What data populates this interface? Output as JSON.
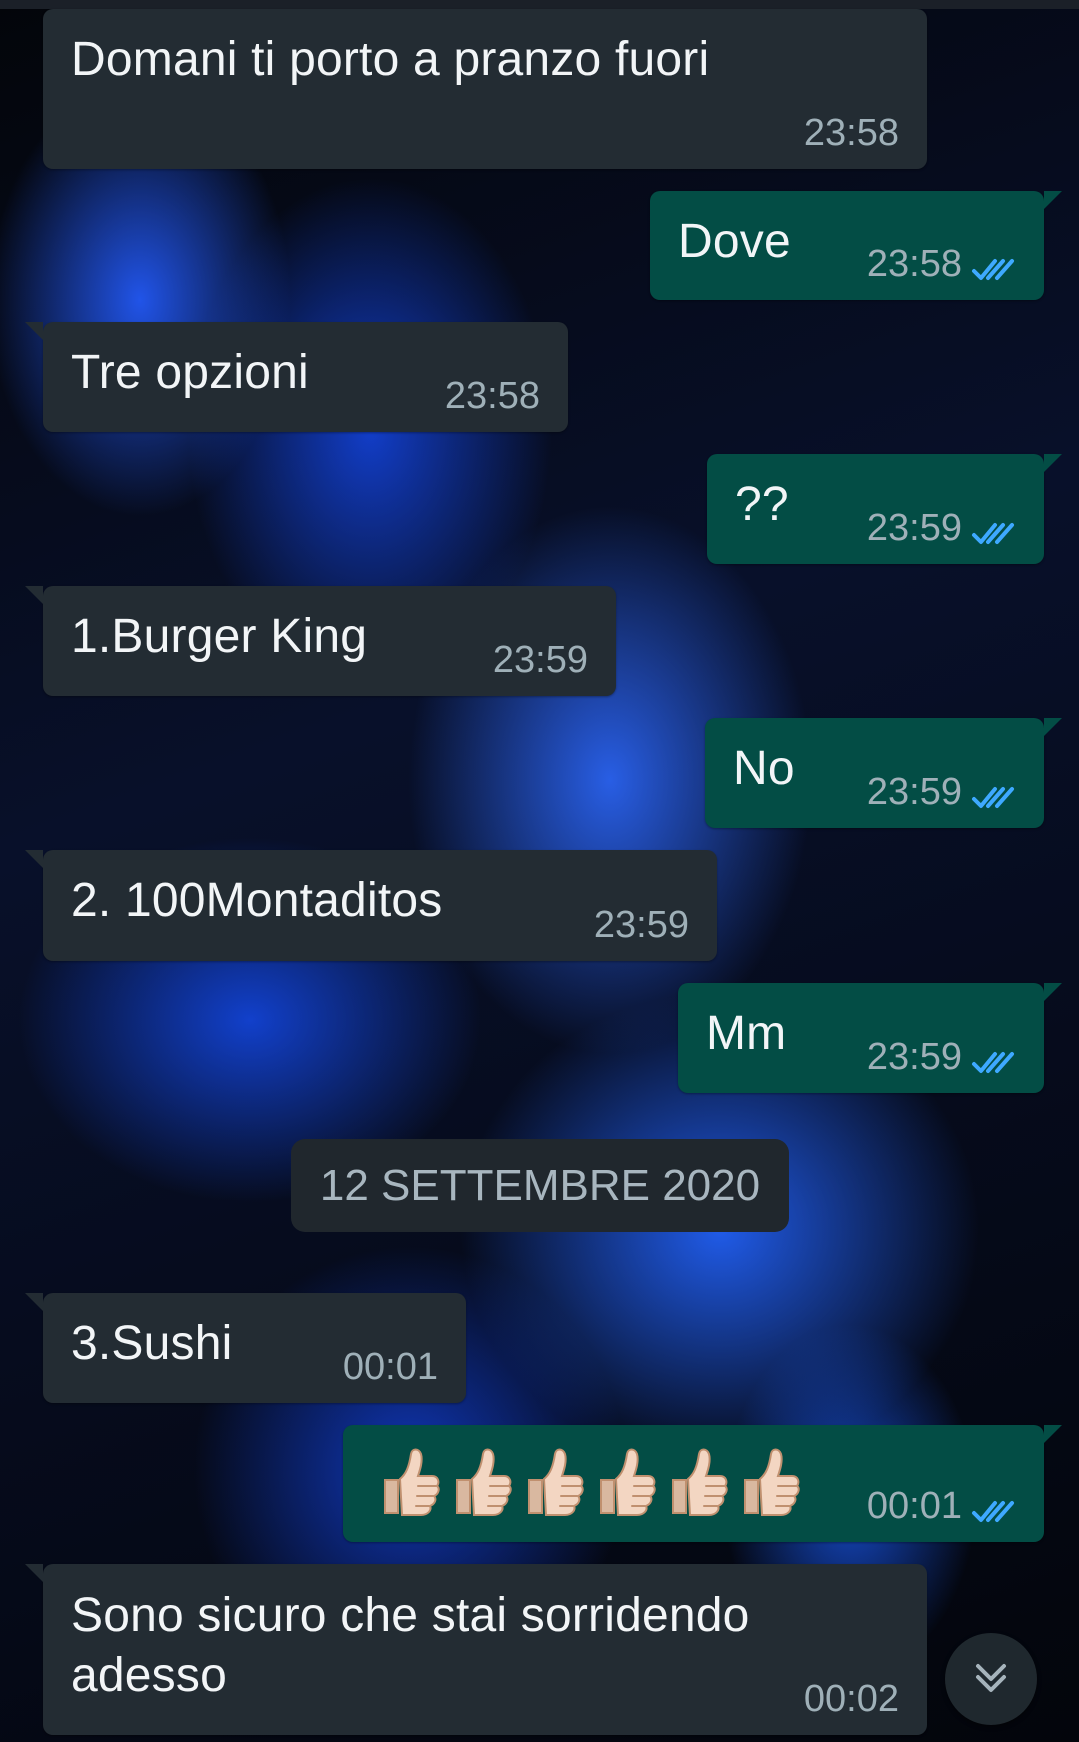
{
  "chat": {
    "messages": [
      {
        "text": "Domani ti porto a pranzo fuori",
        "time": "23:58"
      },
      {
        "text": "Dove",
        "time": "23:58"
      },
      {
        "text": "Tre opzioni",
        "time": "23:58"
      },
      {
        "text": "??",
        "time": "23:59"
      },
      {
        "text": "1.Burger King",
        "time": "23:59"
      },
      {
        "text": "No",
        "time": "23:59"
      },
      {
        "text": "2. 100Montaditos",
        "time": "23:59"
      },
      {
        "text": "Mm",
        "time": "23:59"
      },
      {
        "text": "3.Sushi",
        "time": "00:01"
      },
      {
        "text": "👍🏻👍🏻👍🏻👍🏻👍🏻👍🏻",
        "time": "00:01"
      },
      {
        "text": "Sono sicuro che stai sorridendo adesso",
        "time": "00:02"
      }
    ],
    "date_divider": "12 SETTEMBRE 2020",
    "icons": {
      "read_receipt": "double-check-icon",
      "emoji": "thumbs-up-light-skin-tone-icon",
      "scroll": "scroll-down-chevron-icon"
    },
    "colors": {
      "incoming_bubble": "#232c33",
      "outgoing_bubble": "#034d45",
      "read_tick": "#3ea9ff"
    }
  }
}
